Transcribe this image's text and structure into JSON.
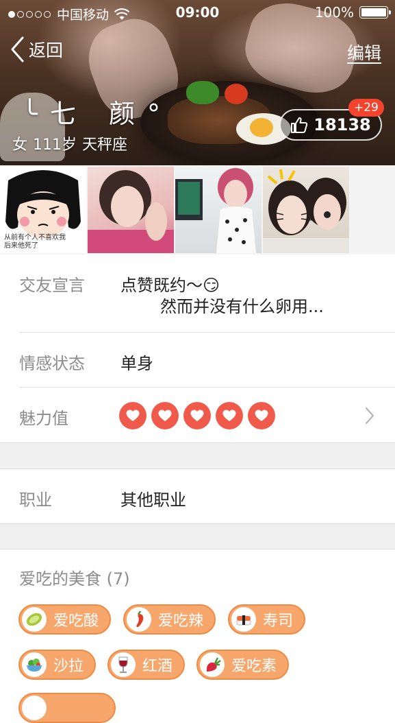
{
  "status_bar": {
    "carrier": "中国移动",
    "time": "09:00",
    "battery": "100%",
    "signal_bars_filled": 1,
    "signal_bars_total": 5
  },
  "nav": {
    "back_label": "返回",
    "edit_label": "编辑"
  },
  "profile": {
    "nickname": "╰七  颜°",
    "gender": "女",
    "age": "111岁",
    "zodiac": "天秤座",
    "likes": "18138",
    "likes_delta": "+29"
  },
  "photos": [
    {
      "name": "photo-1",
      "caption": "从前有个人不喜欢我\n后来他死了"
    },
    {
      "name": "photo-2"
    },
    {
      "name": "photo-3"
    },
    {
      "name": "photo-4"
    }
  ],
  "info": {
    "declaration_label": "交友宣言",
    "declaration_line1": "点赞既约～😏",
    "declaration_line2": "然而并没有什么卵用...",
    "relationship_label": "情感状态",
    "relationship_value": "单身",
    "charm_label": "魅力值",
    "charm_hearts": 5,
    "job_label": "职业",
    "job_value": "其他职业"
  },
  "foods": {
    "title": "爱吃的美食 (7)",
    "tags": [
      {
        "label": "爱吃酸",
        "icon": "lemon-icon"
      },
      {
        "label": "爱吃辣",
        "icon": "chili-icon"
      },
      {
        "label": "寿司",
        "icon": "sushi-icon"
      },
      {
        "label": "沙拉",
        "icon": "salad-icon"
      },
      {
        "label": "红酒",
        "icon": "wine-icon"
      },
      {
        "label": "爱吃素",
        "icon": "radish-icon"
      }
    ]
  },
  "colors": {
    "accent": "#f7a76c",
    "heart": "#f05a4b",
    "badge": "#f4442e"
  }
}
